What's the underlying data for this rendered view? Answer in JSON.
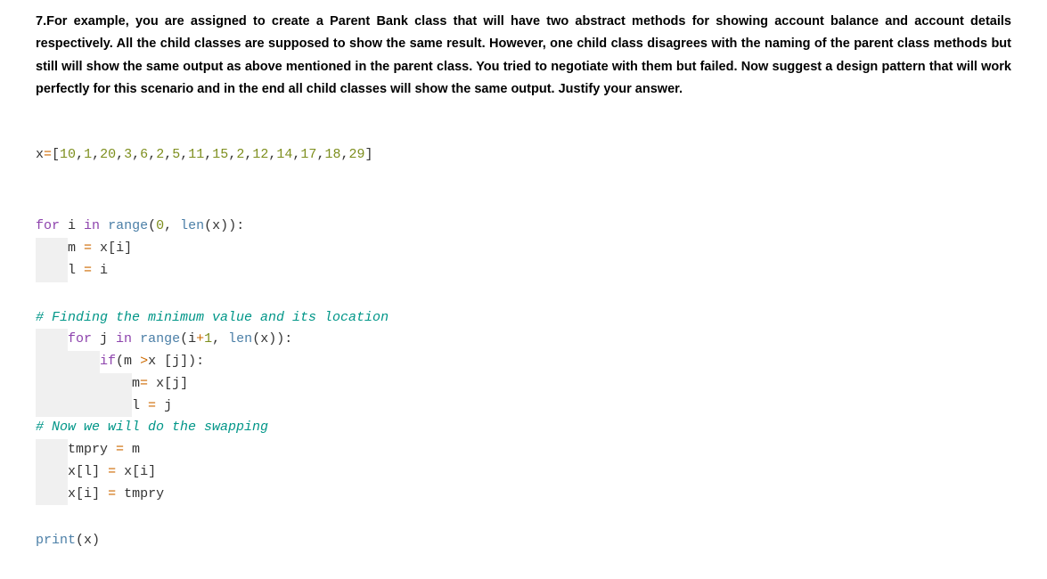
{
  "question": "7.For example, you are assigned to create a Parent Bank class that will have two abstract methods for showing account balance and account details respectively. All the child classes are supposed to show the same result. However, one child class disagrees with the naming of the parent class methods but still will show the same output as above mentioned in the parent class. You tried to negotiate with them but failed. Now suggest a design pattern that will work perfectly for this scenario and in the end all child classes will show the same output. Justify your answer.",
  "code": {
    "l1_a": "x",
    "l1_b": "=",
    "l1_c": "[",
    "l1_d": "10",
    "l1_e": ",",
    "l1_f": "1",
    "l1_g": ",",
    "l1_h": "20",
    "l1_i": ",",
    "l1_j": "3",
    "l1_k": ",",
    "l1_l": "6",
    "l1_m": ",",
    "l1_n": "2",
    "l1_o": ",",
    "l1_p": "5",
    "l1_q": ",",
    "l1_r": "11",
    "l1_s": ",",
    "l1_t": "15",
    "l1_u": ",",
    "l1_v": "2",
    "l1_w": ",",
    "l1_x": "12",
    "l1_y": ",",
    "l1_z": "14",
    "l1_aa": ",",
    "l1_ab": "17",
    "l1_ac": ",",
    "l1_ad": "18",
    "l1_ae": ",",
    "l1_af": "29",
    "l1_ag": "]",
    "l2_a": "for",
    "l2_b": " i ",
    "l2_c": "in",
    "l2_d": " ",
    "l2_e": "range",
    "l2_f": "(",
    "l2_g": "0",
    "l2_h": ", ",
    "l2_i": "len",
    "l2_j": "(",
    "l2_k": "x",
    "l2_l": ")",
    "l2_m": ")",
    "l2_n": ":",
    "indent1": "    ",
    "indent2": "        ",
    "indent3": "            ",
    "l3_a": "m ",
    "l3_b": "=",
    "l3_c": " x",
    "l3_d": "[",
    "l3_e": "i",
    "l3_f": "]",
    "l4_a": "l ",
    "l4_b": "=",
    "l4_c": " i",
    "l5": "# Finding the minimum value and its location",
    "l6_a": "for",
    "l6_b": " j ",
    "l6_c": "in",
    "l6_d": " ",
    "l6_e": "range",
    "l6_f": "(",
    "l6_g": "i",
    "l6_h": "+",
    "l6_i": "1",
    "l6_j": ", ",
    "l6_k": "len",
    "l6_l": "(",
    "l6_m": "x",
    "l6_n": ")",
    "l6_o": ")",
    "l6_p": ":",
    "l7_a": "if",
    "l7_b": "(",
    "l7_c": "m ",
    "l7_d": ">",
    "l7_e": "x ",
    "l7_f": "[",
    "l7_g": "j",
    "l7_h": "]",
    "l7_i": ")",
    "l7_j": ":",
    "l8_a": "m",
    "l8_b": "=",
    "l8_c": " x",
    "l8_d": "[",
    "l8_e": "j",
    "l8_f": "]",
    "l9_a": "l ",
    "l9_b": "=",
    "l9_c": " j",
    "l10": "# Now we will do the swapping",
    "l11_a": "tmpry ",
    "l11_b": "=",
    "l11_c": " m",
    "l12_a": "x",
    "l12_b": "[",
    "l12_c": "l",
    "l12_d": "]",
    "l12_e": " ",
    "l12_f": "=",
    "l12_g": " x",
    "l12_h": "[",
    "l12_i": "i",
    "l12_j": "]",
    "l13_a": "x",
    "l13_b": "[",
    "l13_c": "i",
    "l13_d": "]",
    "l13_e": " ",
    "l13_f": "=",
    "l13_g": " tmpry",
    "l14_a": "print",
    "l14_b": "(",
    "l14_c": "x",
    "l14_d": ")"
  }
}
